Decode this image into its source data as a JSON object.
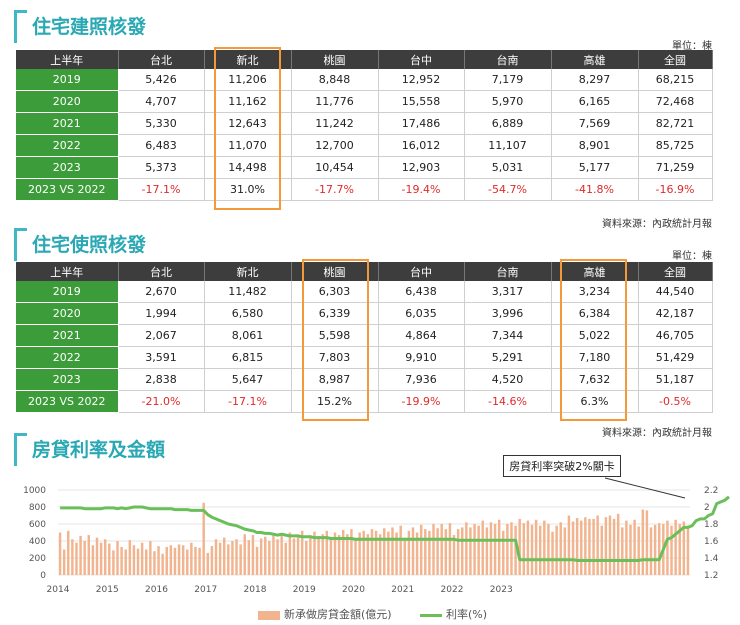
{
  "section1": {
    "title": "住宅建照核發",
    "unit": "單位：棟",
    "source": "資料來源：內政統計月報",
    "headers": [
      "上半年",
      "台北",
      "新北",
      "桃園",
      "台中",
      "台南",
      "高雄",
      "全國"
    ],
    "rows": [
      {
        "label": "2019",
        "cells": [
          "5,426",
          "11,206",
          "8,848",
          "12,952",
          "7,179",
          "8,297",
          "68,215"
        ]
      },
      {
        "label": "2020",
        "cells": [
          "4,707",
          "11,162",
          "11,776",
          "15,558",
          "5,970",
          "6,165",
          "72,468"
        ]
      },
      {
        "label": "2021",
        "cells": [
          "5,330",
          "12,643",
          "11,242",
          "17,486",
          "6,889",
          "7,569",
          "82,721"
        ]
      },
      {
        "label": "2022",
        "cells": [
          "6,483",
          "11,070",
          "12,700",
          "16,012",
          "11,107",
          "8,901",
          "85,725"
        ]
      },
      {
        "label": "2023",
        "cells": [
          "5,373",
          "14,498",
          "10,454",
          "12,903",
          "5,031",
          "5,177",
          "71,259"
        ]
      }
    ],
    "compare": {
      "label": "2023 VS 2022",
      "cells": [
        "-17.1%",
        "31.0%",
        "-17.7%",
        "-19.4%",
        "-54.7%",
        "-41.8%",
        "-16.9%"
      ]
    }
  },
  "section2": {
    "title": "住宅使照核發",
    "unit": "單位：棟",
    "source": "資料來源：內政統計月報",
    "headers": [
      "上半年",
      "台北",
      "新北",
      "桃園",
      "台中",
      "台南",
      "高雄",
      "全國"
    ],
    "rows": [
      {
        "label": "2019",
        "cells": [
          "2,670",
          "11,482",
          "6,303",
          "6,438",
          "3,317",
          "3,234",
          "44,540"
        ]
      },
      {
        "label": "2020",
        "cells": [
          "1,994",
          "6,580",
          "6,339",
          "6,035",
          "3,996",
          "6,384",
          "42,187"
        ]
      },
      {
        "label": "2021",
        "cells": [
          "2,067",
          "8,061",
          "5,598",
          "4,864",
          "7,344",
          "5,022",
          "46,705"
        ]
      },
      {
        "label": "2022",
        "cells": [
          "3,591",
          "6,815",
          "7,803",
          "9,910",
          "5,291",
          "7,180",
          "51,429"
        ]
      },
      {
        "label": "2023",
        "cells": [
          "2,838",
          "5,647",
          "8,987",
          "7,936",
          "4,520",
          "7,632",
          "51,187"
        ]
      }
    ],
    "compare": {
      "label": "2023 VS 2022",
      "cells": [
        "-21.0%",
        "-17.1%",
        "15.2%",
        "-19.9%",
        "-14.6%",
        "6.3%",
        "-0.5%"
      ]
    }
  },
  "section3": {
    "title": "房貸利率及金額",
    "callout": "房貸利率突破2%關卡"
  },
  "colors": {
    "accent": "#2aa8b4",
    "header_bg": "#3d3d3d",
    "row_label_bg": "#3d9c3a",
    "negative": "#e02a2a",
    "highlight": "#f29a3a",
    "bar": "#f2b48e",
    "line": "#6abf5a"
  },
  "chart_data": {
    "type": "bar+line",
    "x_ticks": [
      "2014",
      "2015",
      "2016",
      "2017",
      "2018",
      "2019",
      "2020",
      "2021",
      "2022",
      "2023"
    ],
    "y_left_ticks": [
      "0",
      "200",
      "400",
      "600",
      "800",
      "1000"
    ],
    "y_left_range": [
      0,
      1000
    ],
    "y_right_ticks": [
      "1.2",
      "1.4",
      "1.6",
      "1.8",
      "2",
      "2.2"
    ],
    "y_right_range": [
      1.2,
      2.2
    ],
    "legend": [
      "新承做房貸金額(億元)",
      "利率(%)"
    ],
    "start": "2014-01",
    "bars": [
      500,
      300,
      520,
      420,
      380,
      460,
      400,
      470,
      350,
      440,
      380,
      420,
      370,
      290,
      400,
      330,
      300,
      410,
      350,
      310,
      380,
      300,
      400,
      280,
      340,
      250,
      330,
      350,
      320,
      360,
      350,
      300,
      380,
      330,
      320,
      850,
      260,
      340,
      420,
      380,
      440,
      360,
      400,
      420,
      360,
      480,
      410,
      470,
      330,
      430,
      450,
      400,
      490,
      420,
      470,
      380,
      500,
      430,
      460,
      520,
      400,
      470,
      510,
      460,
      480,
      520,
      440,
      500,
      470,
      530,
      480,
      540,
      420,
      500,
      520,
      480,
      540,
      520,
      480,
      550,
      510,
      560,
      500,
      580,
      440,
      520,
      560,
      500,
      590,
      540,
      520,
      600,
      550,
      600,
      540,
      610,
      470,
      540,
      560,
      620,
      560,
      600,
      580,
      640,
      560,
      620,
      600,
      650,
      520,
      600,
      620,
      580,
      660,
      610,
      640,
      590,
      650,
      580,
      640,
      600,
      510,
      580,
      620,
      560,
      700,
      630,
      670,
      640,
      680,
      660,
      660,
      700,
      580,
      680,
      700,
      660,
      720,
      560,
      640,
      590,
      650,
      570,
      770,
      760,
      560,
      590,
      610,
      600,
      640,
      580,
      650,
      600,
      630,
      580
    ],
    "rate": [
      1.99,
      1.99,
      1.99,
      1.99,
      1.99,
      1.99,
      1.98,
      1.98,
      1.98,
      1.98,
      1.98,
      1.99,
      1.99,
      1.99,
      1.98,
      1.99,
      1.98,
      1.99,
      2.0,
      2.0,
      2.0,
      1.99,
      1.98,
      1.98,
      1.98,
      1.98,
      1.98,
      1.98,
      1.97,
      1.97,
      1.97,
      1.97,
      1.96,
      1.96,
      1.96,
      1.96,
      1.91,
      1.88,
      1.86,
      1.84,
      1.82,
      1.8,
      1.79,
      1.78,
      1.76,
      1.74,
      1.73,
      1.72,
      1.7,
      1.7,
      1.69,
      1.69,
      1.68,
      1.67,
      1.68,
      1.67,
      1.66,
      1.66,
      1.66,
      1.65,
      1.65,
      1.65,
      1.64,
      1.64,
      1.64,
      1.64,
      1.63,
      1.63,
      1.63,
      1.63,
      1.63,
      1.63,
      1.62,
      1.62,
      1.62,
      1.62,
      1.62,
      1.62,
      1.62,
      1.62,
      1.62,
      1.62,
      1.62,
      1.62,
      1.62,
      1.62,
      1.62,
      1.62,
      1.62,
      1.62,
      1.62,
      1.62,
      1.62,
      1.62,
      1.62,
      1.62,
      1.62,
      1.61,
      1.61,
      1.61,
      1.61,
      1.61,
      1.61,
      1.61,
      1.61,
      1.61,
      1.61,
      1.61,
      1.61,
      1.61,
      1.61,
      1.61,
      1.38,
      1.38,
      1.38,
      1.38,
      1.38,
      1.38,
      1.38,
      1.38,
      1.38,
      1.38,
      1.38,
      1.38,
      1.38,
      1.38,
      1.37,
      1.37,
      1.37,
      1.37,
      1.37,
      1.37,
      1.37,
      1.37,
      1.37,
      1.37,
      1.37,
      1.37,
      1.37,
      1.37,
      1.37,
      1.37,
      1.38,
      1.38,
      1.38,
      1.38,
      1.38,
      1.5,
      1.62,
      1.64,
      1.68,
      1.72,
      1.76,
      1.76,
      1.78,
      1.84,
      1.86,
      1.86,
      1.9,
      1.92,
      2.04,
      2.06,
      2.08,
      2.12
    ]
  }
}
